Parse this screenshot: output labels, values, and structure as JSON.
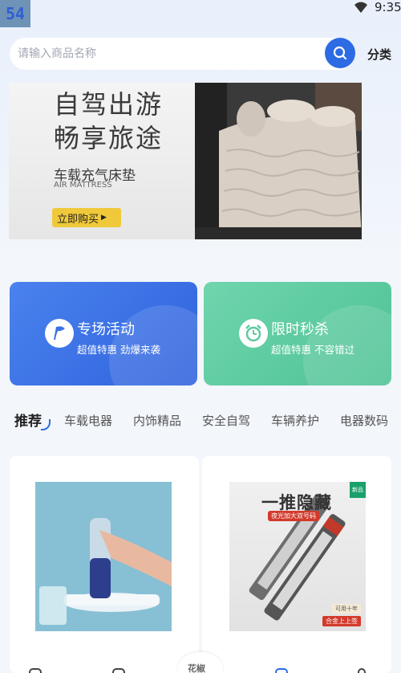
{
  "status_bar": {
    "badge": "54",
    "time": "9:35"
  },
  "search": {
    "placeholder": "请输入商品名称",
    "category_label": "分类"
  },
  "banner": {
    "title_line1": "自驾出游",
    "title_line2": "畅享旅途",
    "subtitle": "车载充气床垫",
    "subtitle_en": "AIR MATTRESS",
    "button_label": "立即购买"
  },
  "promos": [
    {
      "title": "专场活动",
      "subtitle": "超值特惠 劲爆来袭",
      "icon": "flag-icon",
      "color": "#3a70e6"
    },
    {
      "title": "限时秒杀",
      "subtitle": "超值特惠 不容错过",
      "icon": "alarm-clock-icon",
      "color": "#5ccaa0"
    }
  ],
  "tabs": [
    {
      "label": "推荐"
    },
    {
      "label": "车载电器"
    },
    {
      "label": "内饰精品"
    },
    {
      "label": "安全自驾"
    },
    {
      "label": "车辆养护"
    },
    {
      "label": "电器数码"
    }
  ],
  "products": [
    {
      "image": "car-fragrance-spray-bottle"
    },
    {
      "image": "parking-phone-number-plate",
      "label1": "一推隐藏",
      "label2": "夜光加大双号码",
      "tag": "新品",
      "foot1": "可用十年",
      "foot2": "合金上上签"
    }
  ],
  "bottom_nav": {
    "center_label": "花椒"
  },
  "colors": {
    "accent": "#2d6be4",
    "green": "#5ccaa0",
    "banner_button": "#f0c93a"
  }
}
